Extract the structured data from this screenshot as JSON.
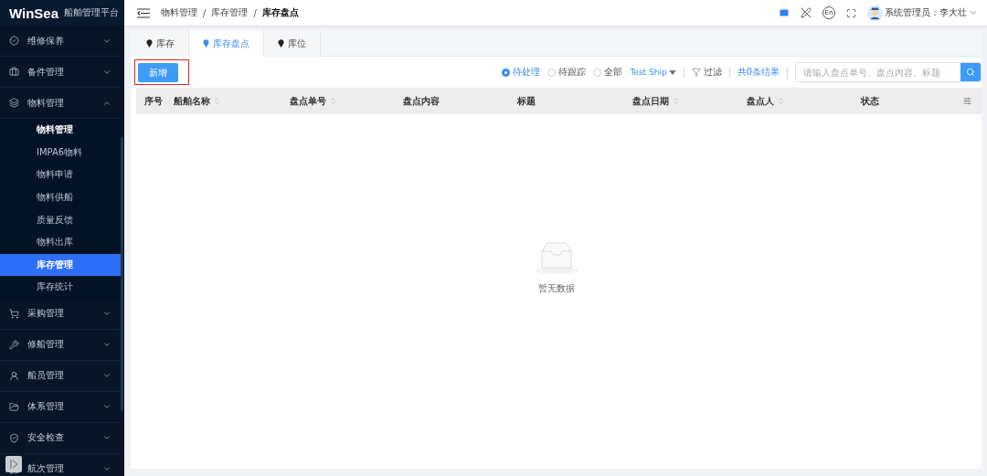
{
  "sidebar": {
    "logo": "WinSea",
    "subtitle": "船舶管理平台",
    "groups": [
      {
        "label": "维修保养",
        "expanded": false
      },
      {
        "label": "备件管理",
        "expanded": false
      },
      {
        "label": "物料管理",
        "expanded": true,
        "children": [
          {
            "label": "物料管理",
            "selected": false,
            "bold": true
          },
          {
            "label": "IMPA6物料",
            "selected": false,
            "bold": false
          },
          {
            "label": "物料申请",
            "selected": false,
            "bold": false
          },
          {
            "label": "物料供船",
            "selected": false,
            "bold": false
          },
          {
            "label": "质量反馈",
            "selected": false,
            "bold": false
          },
          {
            "label": "物料出库",
            "selected": false,
            "bold": false
          },
          {
            "label": "库存管理",
            "selected": true,
            "bold": false
          },
          {
            "label": "库存统计",
            "selected": false,
            "bold": false
          }
        ]
      },
      {
        "label": "采购管理",
        "expanded": false
      },
      {
        "label": "修船管理",
        "expanded": false
      },
      {
        "label": "船员管理",
        "expanded": false
      },
      {
        "label": "体系管理",
        "expanded": false
      },
      {
        "label": "安全检查",
        "expanded": false
      },
      {
        "label": "航次管理",
        "expanded": false
      }
    ]
  },
  "header": {
    "breadcrumb": [
      "物料管理",
      "库存管理",
      "库存盘点"
    ],
    "separators": [
      "/",
      "/"
    ],
    "user": "系统管理员：李大壮",
    "language": "En"
  },
  "tabs": [
    {
      "label": "库存",
      "selected": false
    },
    {
      "label": "库存盘点",
      "selected": true
    },
    {
      "label": "库位",
      "selected": false
    }
  ],
  "toolbar": {
    "add_button": "新增",
    "filters": [
      {
        "label": "待处理",
        "selected": true
      },
      {
        "label": "待跟踪",
        "selected": false
      },
      {
        "label": "全部",
        "selected": false
      }
    ],
    "ship": "Test Ship",
    "filter": "过滤",
    "result_count": "共0条结果",
    "search": {
      "placeholder": "请输入盘点单号、盘点内容、标题"
    }
  },
  "table": {
    "columns": [
      {
        "label": "序号"
      },
      {
        "label": "船舶名称",
        "sortable": true
      },
      {
        "label": "盘点单号",
        "sortable": true
      },
      {
        "label": "盘点内容"
      },
      {
        "label": "标题"
      },
      {
        "label": "盘点日期",
        "sortable": true
      },
      {
        "label": "盘点人",
        "sortable": true
      },
      {
        "label": "状态"
      }
    ],
    "empty_text": "暂无数据"
  }
}
